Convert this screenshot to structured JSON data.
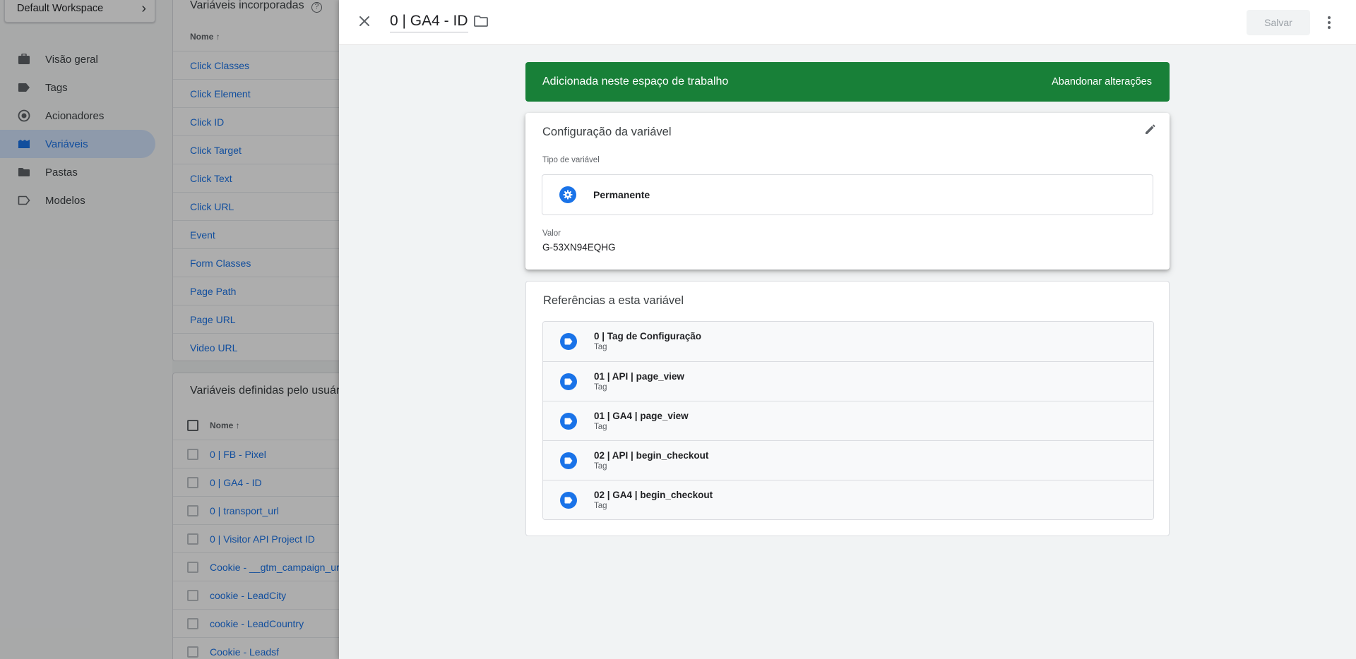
{
  "background": {
    "workspace": {
      "name": "Default Workspace"
    },
    "nav": [
      {
        "label": "Visão geral",
        "icon": "briefcase-icon",
        "active": false
      },
      {
        "label": "Tags",
        "icon": "tag-icon",
        "active": false
      },
      {
        "label": "Acionadores",
        "icon": "trigger-icon",
        "active": false
      },
      {
        "label": "Variáveis",
        "icon": "variables-icon",
        "active": true
      },
      {
        "label": "Pastas",
        "icon": "folder-icon",
        "active": false
      },
      {
        "label": "Modelos",
        "icon": "template-icon",
        "active": false
      }
    ],
    "builtin": {
      "title": "Variáveis incorporadas",
      "column": "Nome",
      "sort_icon": "arrow-up",
      "help_icon": "help-icon",
      "rows": [
        "Click Classes",
        "Click Element",
        "Click ID",
        "Click Target",
        "Click Text",
        "Click URL",
        "Event",
        "Form Classes",
        "Page Path",
        "Page URL",
        "Video URL"
      ]
    },
    "user_defined": {
      "title": "Variáveis definidas pelo usuário",
      "column": "Nome",
      "sort_icon": "arrow-up",
      "rows": [
        "0 | FB - Pixel",
        "0 | GA4 - ID",
        "0 | transport_url",
        "0 | Visitor API Project ID",
        "Cookie - __gtm_campaign_url",
        "cookie - LeadCity",
        "cookie - LeadCountry",
        "Cookie - Leadsf"
      ]
    }
  },
  "panel": {
    "title": "0 | GA4 - ID",
    "save_label": "Salvar",
    "close_icon": "close-icon",
    "folder_icon": "folder-icon",
    "more_icon": "more-vert-icon",
    "banner": {
      "text": "Adicionada neste espaço de trabalho",
      "action": "Abandonar alterações",
      "color": "#188038"
    },
    "config": {
      "title": "Configuração da variável",
      "edit_icon": "pencil-icon",
      "type_label": "Tipo de variável",
      "type_name": "Permanente",
      "type_icon": "gear-icon",
      "value_label": "Valor",
      "value": "G-53XN94EQHG"
    },
    "references": {
      "title": "Referências a esta variável",
      "items": [
        {
          "name": "0 | Tag de Configuração",
          "type": "Tag",
          "icon": "tag-icon"
        },
        {
          "name": "01 | API | page_view",
          "type": "Tag",
          "icon": "tag-icon"
        },
        {
          "name": "01 | GA4 | page_view",
          "type": "Tag",
          "icon": "tag-icon"
        },
        {
          "name": "02 | API | begin_checkout",
          "type": "Tag",
          "icon": "tag-icon"
        },
        {
          "name": "02 | GA4 | begin_checkout",
          "type": "Tag",
          "icon": "tag-icon"
        }
      ]
    }
  },
  "colors": {
    "accent": "#1a73e8",
    "success": "#188038"
  }
}
